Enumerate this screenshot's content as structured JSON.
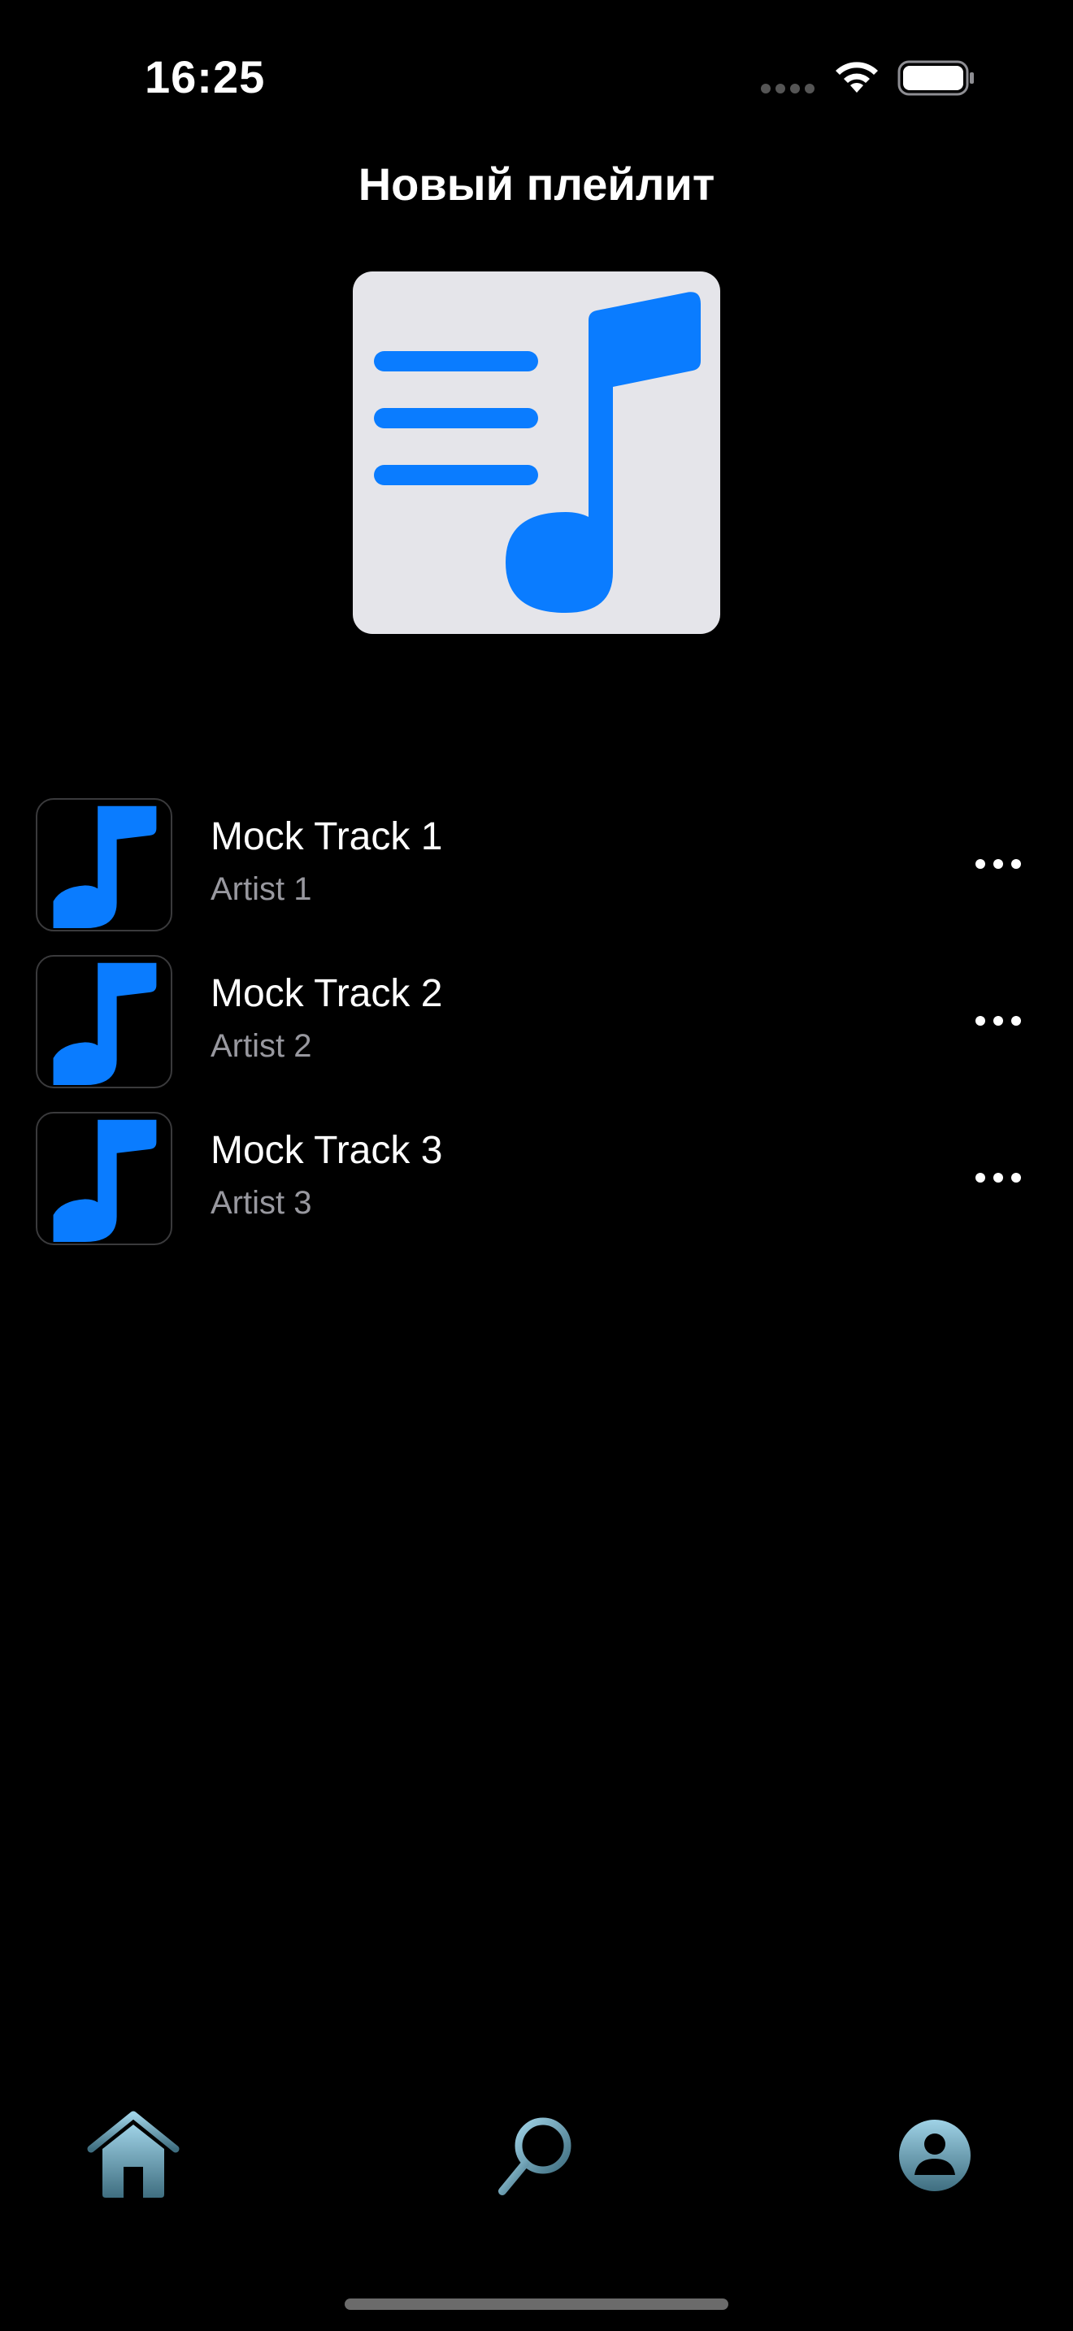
{
  "status_bar": {
    "time": "16:25"
  },
  "header": {
    "title": "Новый плейлит"
  },
  "playlist": {
    "cover_icon": "playlist-music-icon",
    "accent_color": "#0a7cff",
    "tracks": [
      {
        "title": "Mock Track 1",
        "artist": "Artist 1"
      },
      {
        "title": "Mock Track 2",
        "artist": "Artist 2"
      },
      {
        "title": "Mock Track 3",
        "artist": "Artist 3"
      }
    ]
  },
  "tab_bar": {
    "items": [
      {
        "icon": "home-icon",
        "selected": true
      },
      {
        "icon": "search-icon",
        "selected": false
      },
      {
        "icon": "profile-icon",
        "selected": false
      }
    ],
    "gradient_colors": [
      "#9fd2e6",
      "#3f6e80"
    ]
  }
}
